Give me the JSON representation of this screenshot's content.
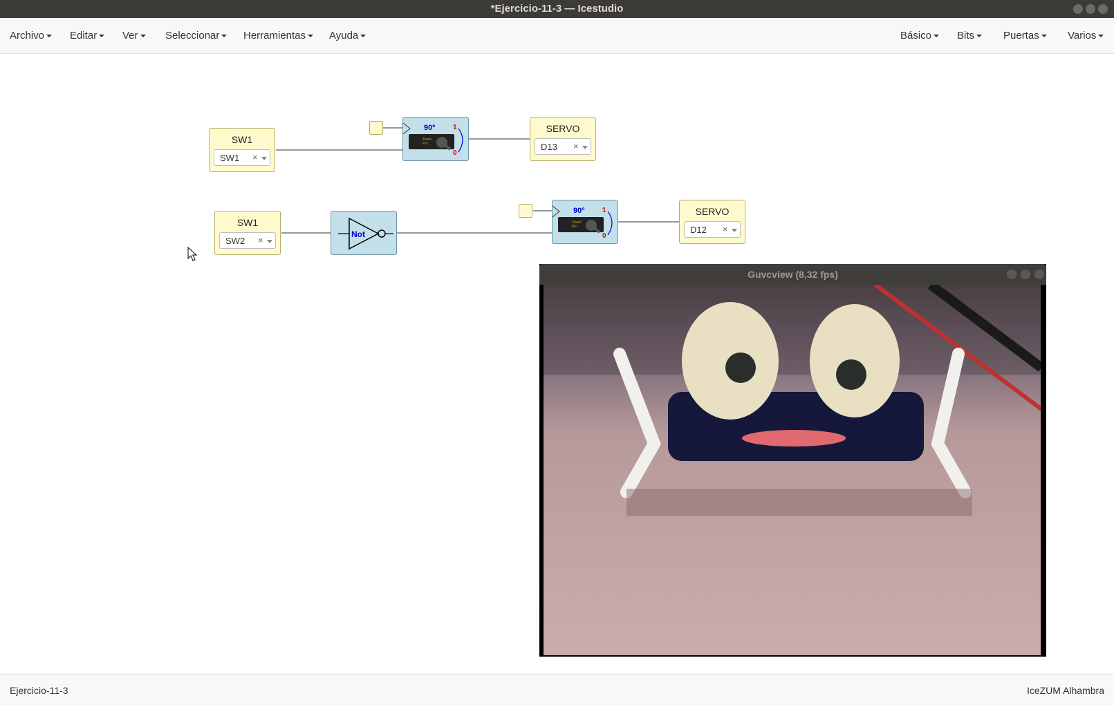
{
  "window": {
    "title": "*Ejercicio-11-3 — Icestudio"
  },
  "menubar": {
    "left": [
      {
        "label": "Archivo"
      },
      {
        "label": "Editar"
      },
      {
        "label": "Ver"
      },
      {
        "label": "Seleccionar"
      },
      {
        "label": "Herramientas"
      },
      {
        "label": "Ayuda"
      }
    ],
    "right": [
      {
        "label": "Básico"
      },
      {
        "label": "Bits"
      },
      {
        "label": "Puertas"
      },
      {
        "label": "Varios"
      }
    ]
  },
  "circuit": {
    "input1": {
      "title": "SW1",
      "value": "SW1",
      "clear": "×"
    },
    "input2": {
      "title": "SW1",
      "value": "SW2",
      "clear": "×"
    },
    "output1": {
      "title": "SERVO",
      "value": "D13",
      "clear": "×"
    },
    "output2": {
      "title": "SERVO",
      "value": "D12",
      "clear": "×"
    },
    "servo1": {
      "angle": "90º",
      "high": "1",
      "low": "0",
      "brand": "Tower Pro SG-90"
    },
    "servo2": {
      "angle": "90º",
      "high": "1",
      "low": "0",
      "brand": "Tower Pro SG-90"
    },
    "not_gate": {
      "label": "Not"
    }
  },
  "guvcview": {
    "title": "Guvcview  (8,32 fps)"
  },
  "statusbar": {
    "file": "Ejercicio-11-3",
    "board": "IceZUM Alhambra"
  },
  "colors": {
    "io_block": "#fffacd",
    "logic_block": "#c3dfe9",
    "titlebar": "#3c3b37",
    "wire": "#777777"
  }
}
